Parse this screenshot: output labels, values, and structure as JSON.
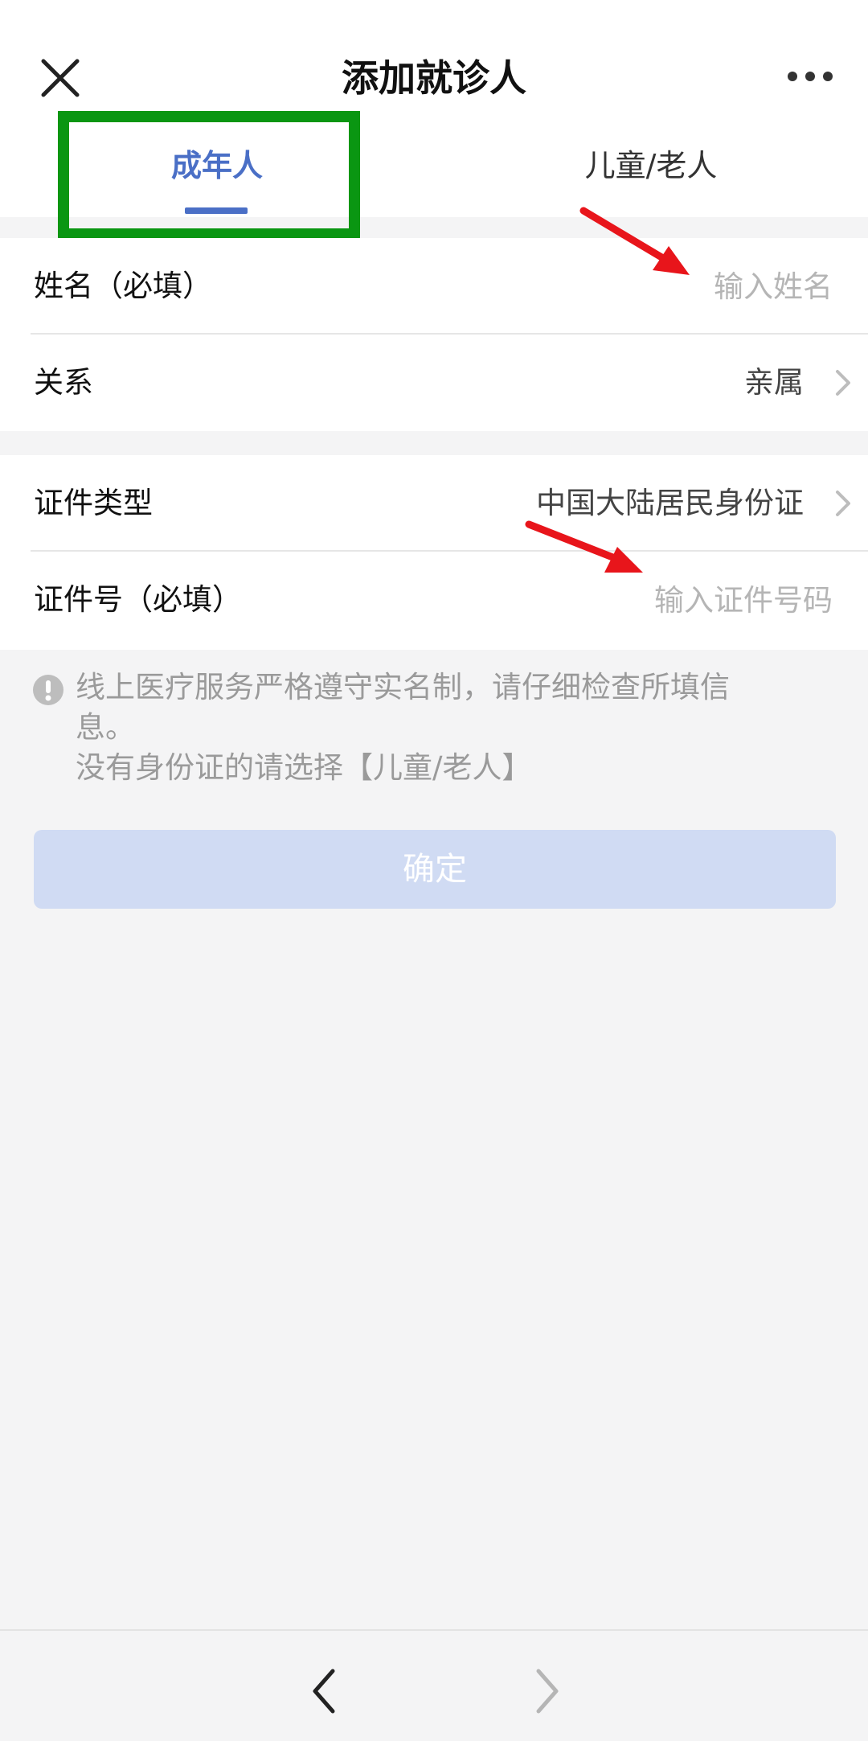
{
  "header": {
    "title": "添加就诊人",
    "close_icon": "close-icon",
    "more_icon": "more-icon"
  },
  "tabs": [
    {
      "label": "成年人",
      "active": true
    },
    {
      "label": "儿童/老人",
      "active": false
    }
  ],
  "form": {
    "name": {
      "label": "姓名（必填）",
      "placeholder": "输入姓名",
      "value": ""
    },
    "relation": {
      "label": "关系",
      "value": "亲属"
    },
    "id_type": {
      "label": "证件类型",
      "value": "中国大陆居民身份证"
    },
    "id_number": {
      "label": "证件号（必填）",
      "placeholder": "输入证件号码",
      "value": ""
    }
  },
  "notice": {
    "line1": "线上医疗服务严格遵守实名制，请仔细检查所填信",
    "line2": "息。",
    "line3": "没有身份证的请选择【儿童/老人】"
  },
  "confirm_label": "确定",
  "colors": {
    "accent": "#4a6fc6",
    "highlight_box": "#0a9612",
    "annotation_arrow": "#e8151b",
    "confirm_disabled": "#d0dbf3"
  }
}
